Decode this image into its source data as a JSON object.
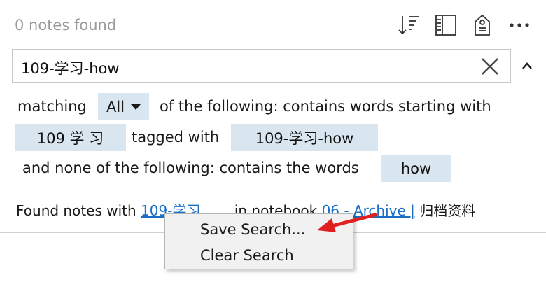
{
  "header": {
    "count_text": "0 notes found",
    "icons": [
      "sort-icon",
      "view-layout-icon",
      "tag-filter-icon",
      "more-icon"
    ]
  },
  "search": {
    "query": "109-学习-how"
  },
  "query_builder": {
    "matching_label": "matching",
    "match_mode": "All",
    "row1_text": "of the following:  contains words starting with",
    "chip_words": "109 学 习",
    "tagged_with_label": "tagged with",
    "chip_tag": "109-学习-how",
    "row3_text": "and none of the following:  contains the words",
    "chip_excluded": "how"
  },
  "found_line": {
    "prefix": "Found notes with",
    "link_query": "109-学习",
    "middle": "in notebook",
    "notebook_link": "06 - Archive |",
    "notebook_suffix": "归档资料"
  },
  "context_menu": {
    "items": [
      "Save Search...",
      "Clear Search"
    ]
  },
  "colors": {
    "chip_bg": "#d9e6ef",
    "link": "#1a6fc4",
    "arrow": "#e02020"
  }
}
